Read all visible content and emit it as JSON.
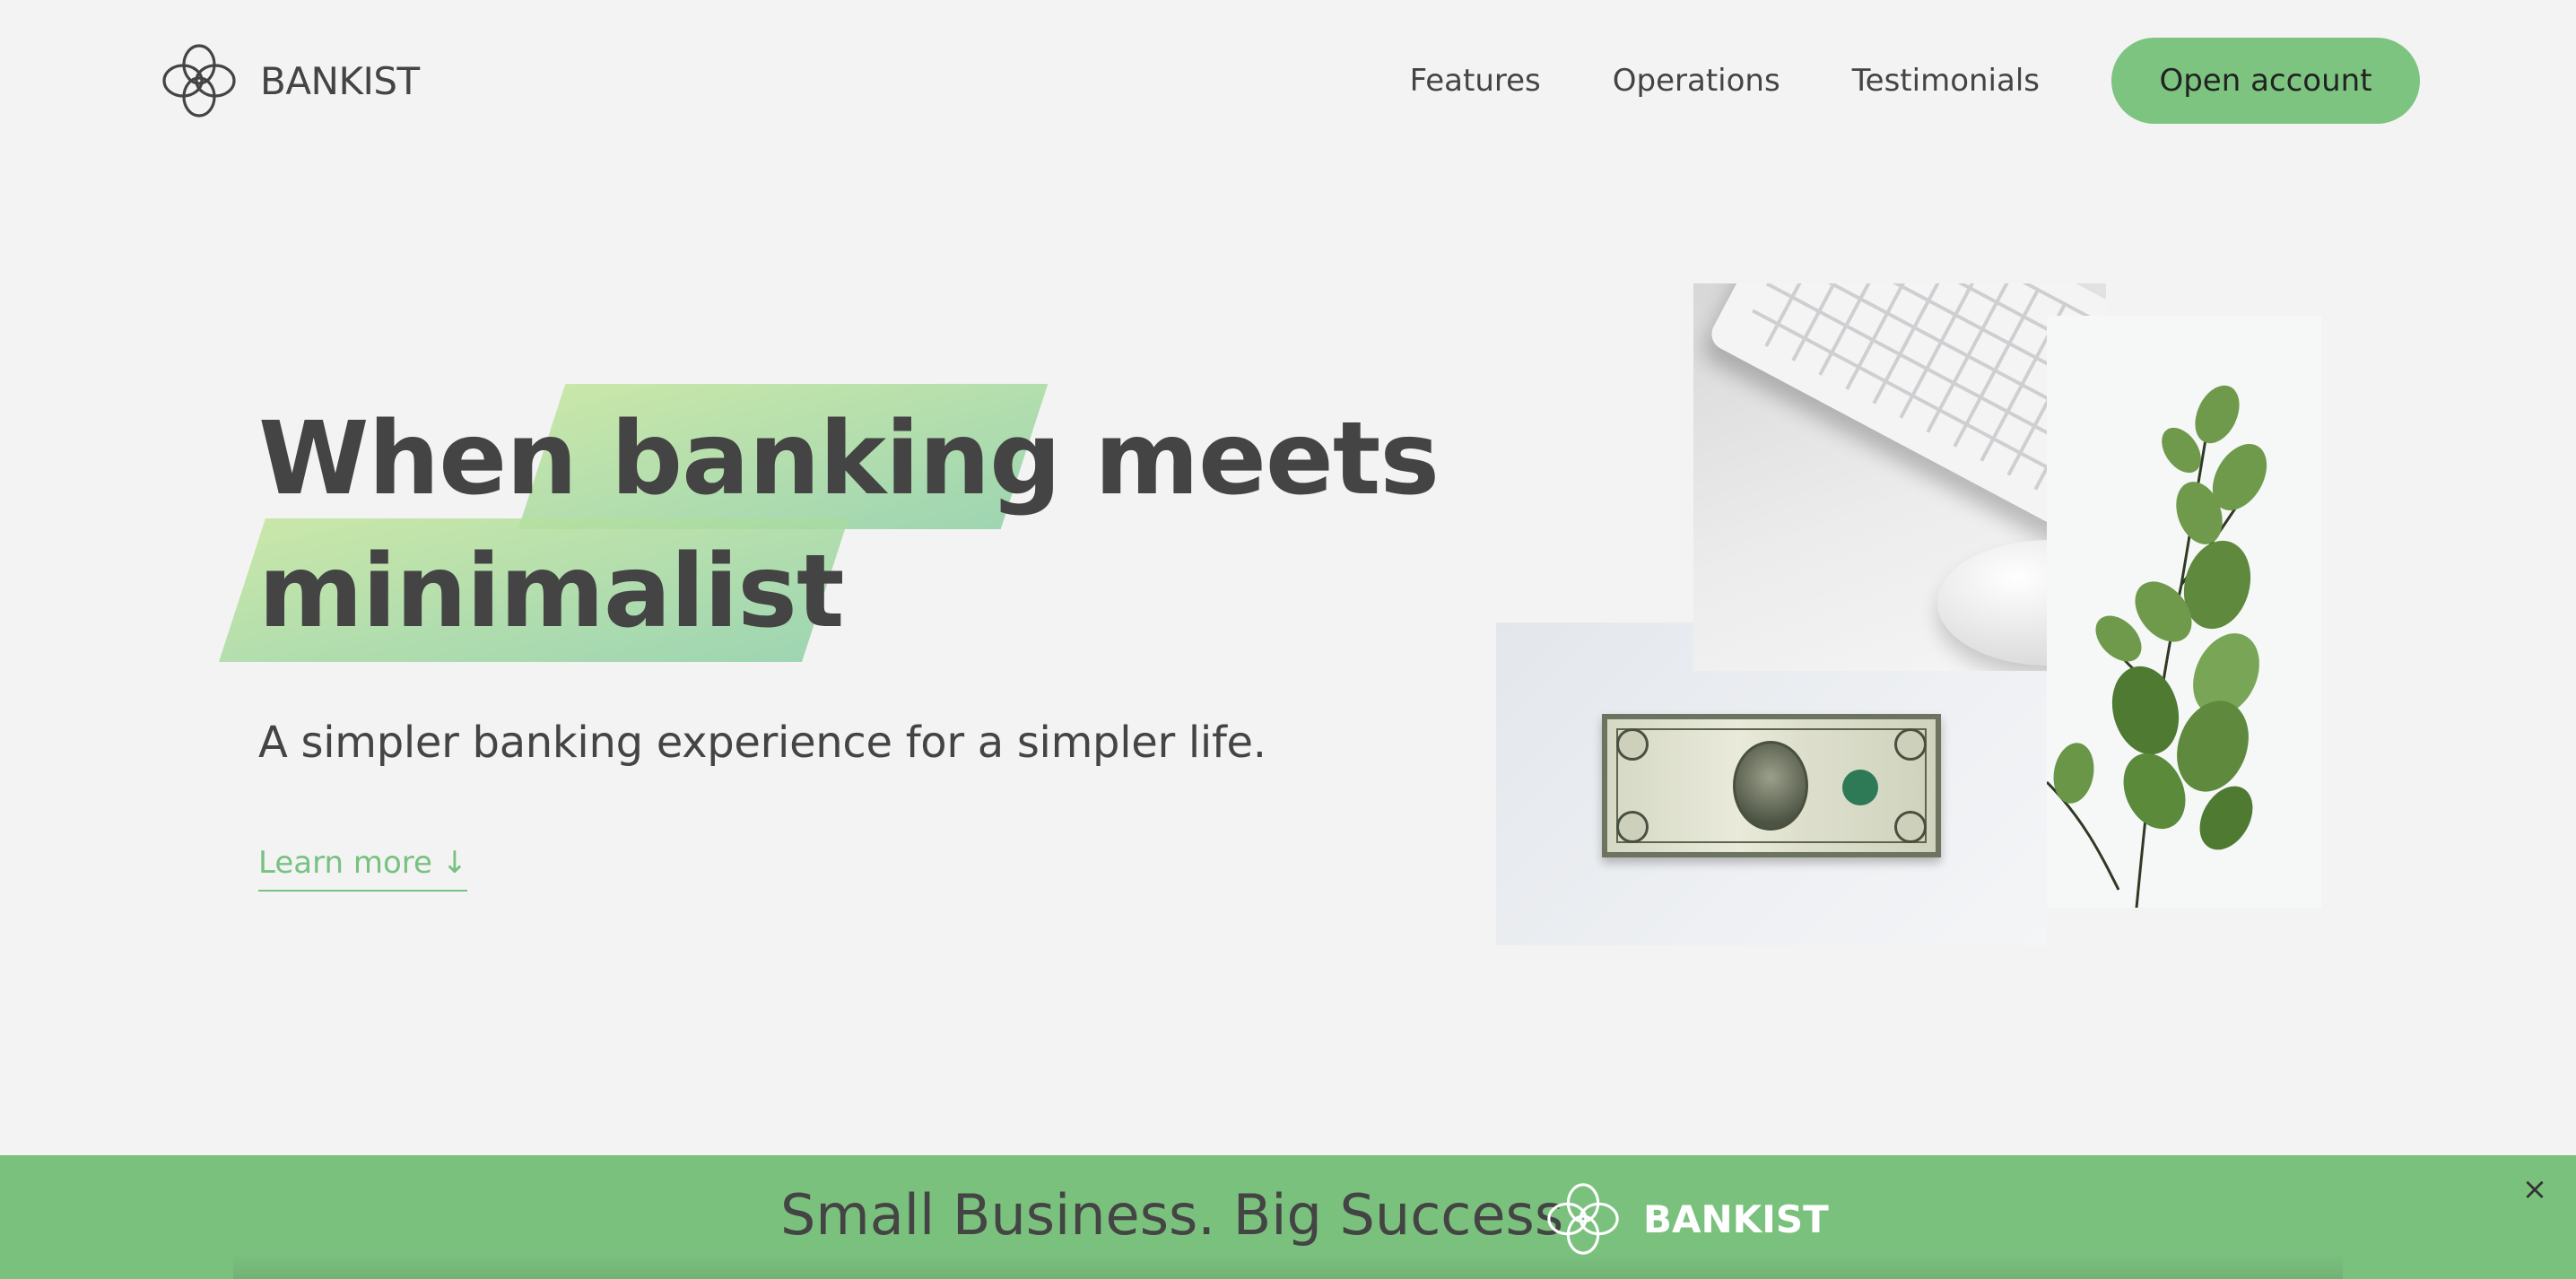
{
  "nav": {
    "brand": "BANKIST",
    "links": [
      {
        "label": "Features"
      },
      {
        "label": "Operations"
      },
      {
        "label": "Testimonials"
      }
    ],
    "cta": "Open account"
  },
  "hero": {
    "title_line1_w1": "When",
    "title_line1_w2": "banking",
    "title_line1_w3": "meets",
    "title_line2": "minimalist",
    "subtitle": "A simpler banking experience for a simpler life.",
    "learn_more": "Learn more ↓"
  },
  "banner": {
    "text": "Small Business. Big Success",
    "brand": "BANKIST",
    "close": "×"
  },
  "colors": {
    "accent": "#7cc47f",
    "banner": "#7bc17e",
    "text": "#444444",
    "background": "#f3f3f3"
  },
  "icons": {
    "logo": "bankist-logo-icon",
    "close": "close-icon"
  }
}
